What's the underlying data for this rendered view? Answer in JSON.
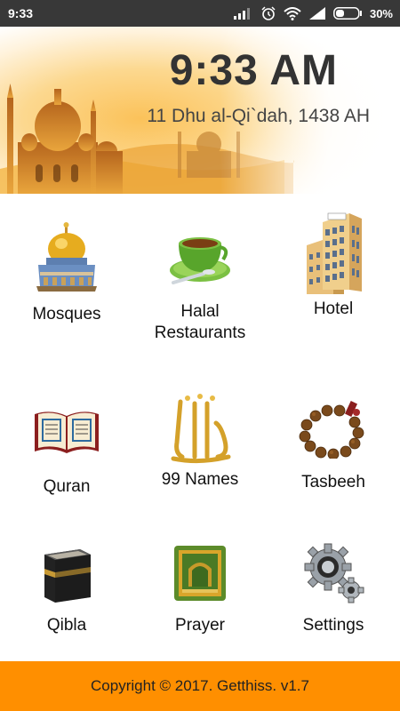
{
  "status_bar": {
    "time": "9:33",
    "battery": "30%"
  },
  "header": {
    "clock": "9:33 AM",
    "hijri_date": "11 Dhu al-Qi`dah, 1438 AH"
  },
  "menu": [
    {
      "label": "Mosques",
      "icon": "mosque-icon"
    },
    {
      "label": "Halal Restaurants",
      "icon": "tea-cup-icon"
    },
    {
      "label": "Hotel",
      "icon": "hotel-building-icon"
    },
    {
      "label": "Quran",
      "icon": "open-quran-icon"
    },
    {
      "label": "99 Names",
      "icon": "allah-calligraphy-icon"
    },
    {
      "label": "Tasbeeh",
      "icon": "prayer-beads-icon"
    },
    {
      "label": "Qibla",
      "icon": "kaaba-icon"
    },
    {
      "label": "Prayer",
      "icon": "prayer-mat-icon"
    },
    {
      "label": "Settings",
      "icon": "gears-icon"
    }
  ],
  "footer": {
    "copyright": "Copyright © 2017. Getthiss. v1.7"
  },
  "colors": {
    "footer": "#ff8f00",
    "status_bar": "#383838",
    "banner": "#f5a623"
  }
}
